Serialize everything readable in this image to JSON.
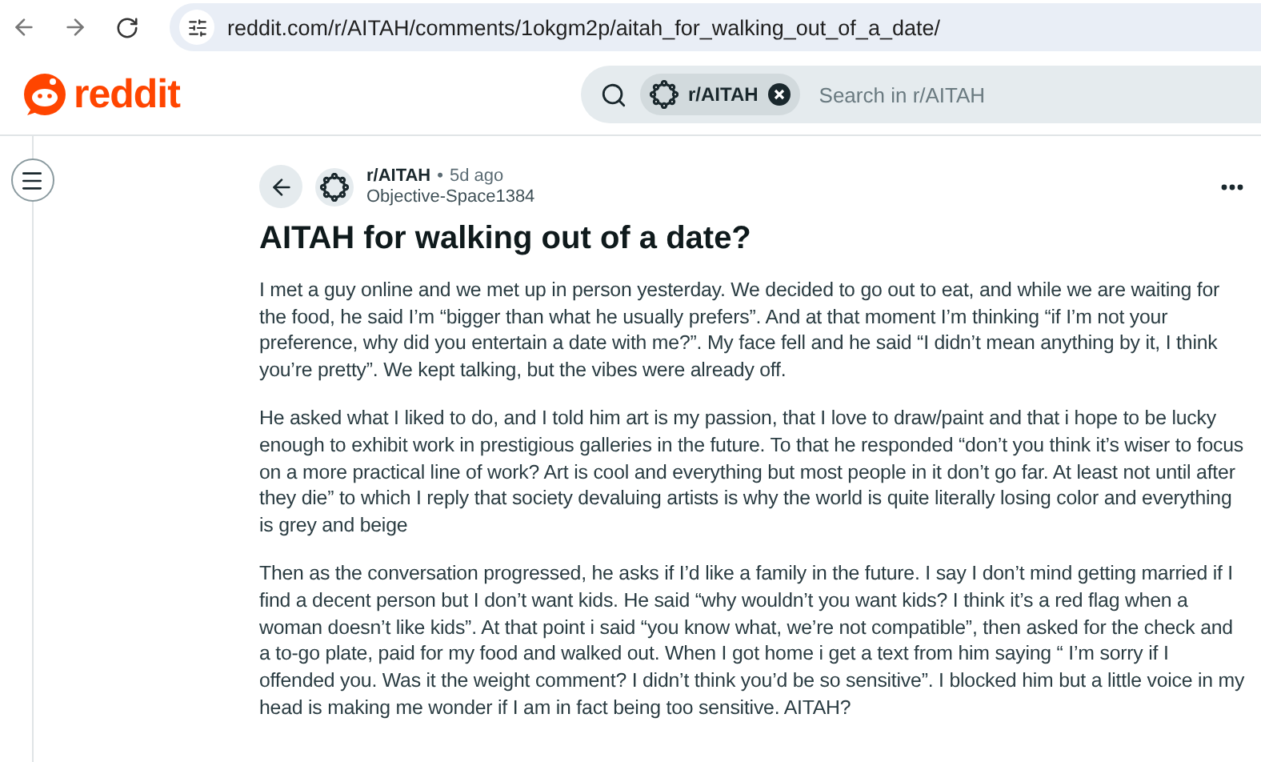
{
  "browser": {
    "url": "reddit.com/r/AITAH/comments/1okgm2p/aitah_for_walking_out_of_a_date/"
  },
  "header": {
    "logo": "reddit",
    "search": {
      "chip": "r/AITAH",
      "placeholder": "Search in r/AITAH"
    }
  },
  "post": {
    "subreddit": "r/AITAH",
    "separator": "•",
    "age": "5d ago",
    "author": "Objective-Space1384",
    "title": "AITAH for walking out of a date?",
    "paragraphs": [
      "I met a guy online and we met up in person yesterday. We decided to go out to eat, and while we are waiting for the food, he said I’m “bigger than what he usually prefers”. And at that moment I’m thinking “if I’m not your preference, why did you entertain a date with me?”. My face fell and he said “I didn’t mean anything by it, I think you’re pretty”. We kept talking, but the vibes were already off.",
      "He asked what I liked to do, and I told him art is my passion, that I love to draw/paint and that i hope to be lucky enough to exhibit work in prestigious galleries in the future. To that he responded “don’t you think it’s wiser to focus on a more practical line of work? Art is cool and everything but most people in it don’t go far. At least not until after they die” to which I reply that society devaluing artists is why the world is quite literally losing color and everything is grey and beige",
      "Then as the conversation progressed, he asks if I’d like a family in the future. I say I don’t mind getting married if I find a decent person but I don’t want kids. He said “why wouldn’t you want kids? I think it’s a red flag when a woman doesn’t like kids”. At that point i said “you know what, we’re not compatible”, then asked for the check and a to-go plate, paid for my food and walked out. When I got home i get a text from him saying “ I’m sorry if I offended you. Was it the weight comment? I didn’t think you’d be so sensitive”. I blocked him but a little voice in my head is making me wonder if I am in fact being too sensitive. AITAH?"
    ]
  }
}
